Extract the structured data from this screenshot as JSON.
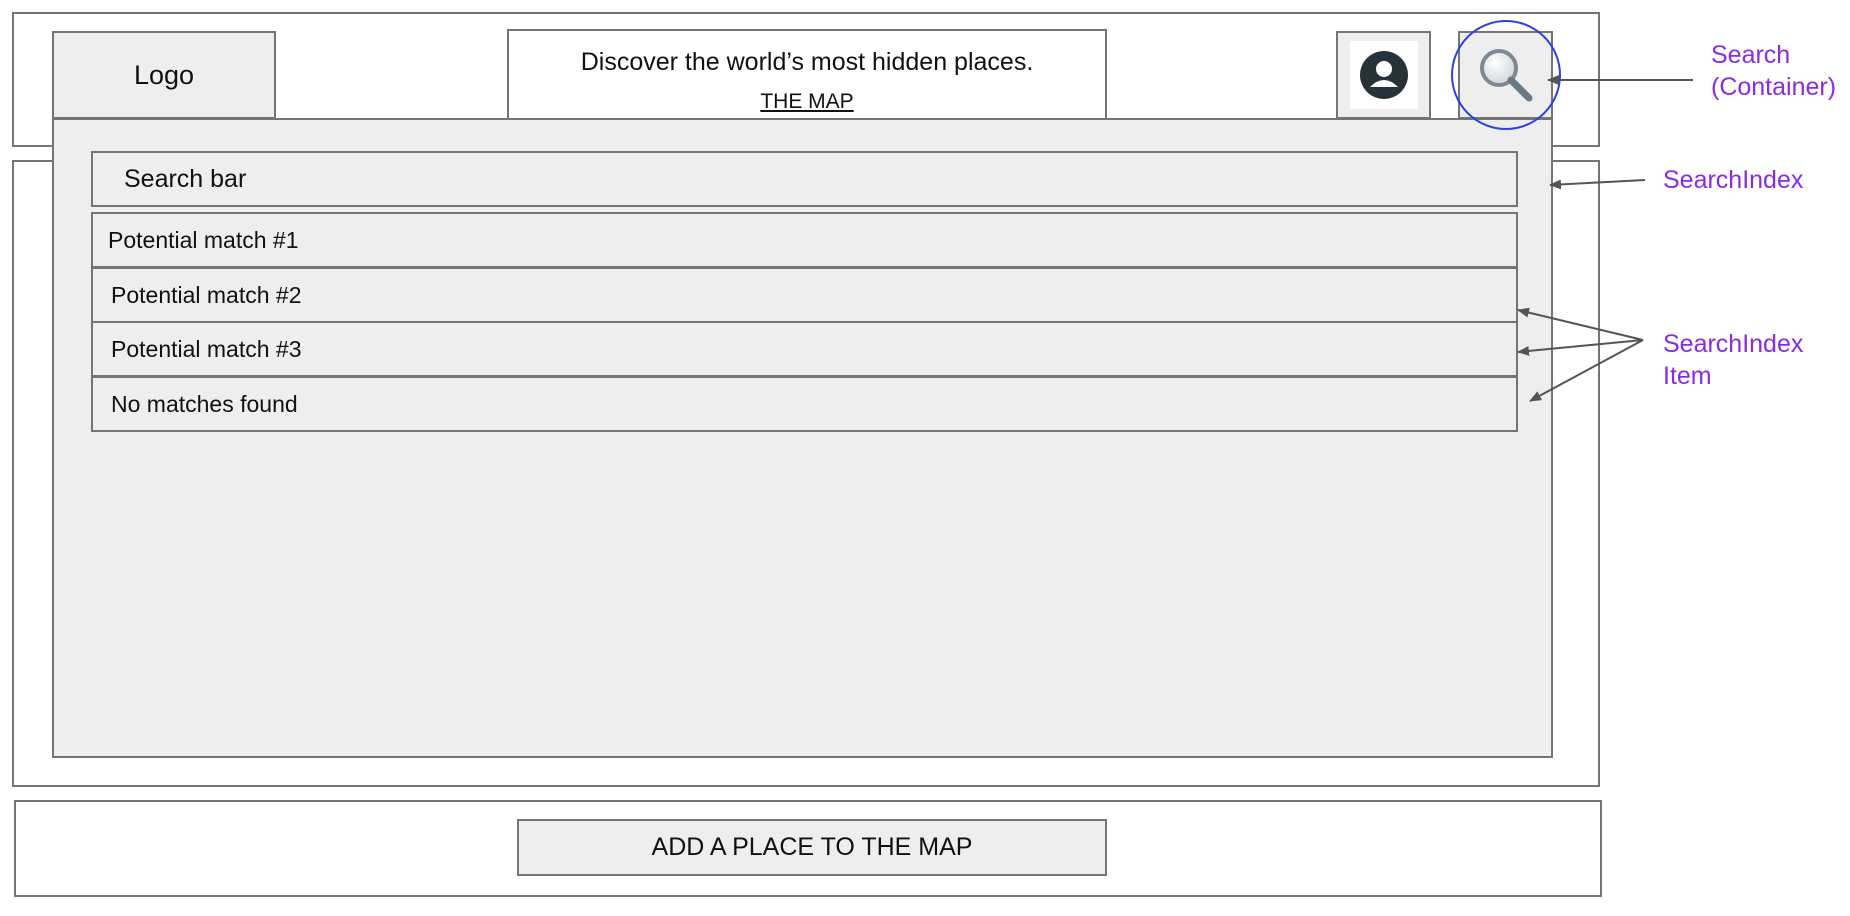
{
  "header": {
    "logo_label": "Logo",
    "tagline": "Discover the world’s most hidden places.",
    "map_link": "THE MAP"
  },
  "icons": {
    "profile": "user-avatar-icon",
    "search": "magnifying-glass-icon"
  },
  "search": {
    "bar_label": "Search bar",
    "items": [
      "Potential match #1",
      "Potential match #2",
      "Potential match #3",
      "No matches found"
    ]
  },
  "footer": {
    "add_place_label": "ADD A PLACE TO THE MAP"
  },
  "annotations": {
    "search_container_line1": "Search",
    "search_container_line2": "(Container)",
    "search_index": "SearchIndex",
    "search_index_item_line1": "SearchIndex",
    "search_index_item_line2": "Item"
  },
  "colors": {
    "annotation": "#8a2be2",
    "highlight_circle": "#2f3fe0",
    "box_fill": "#eeeeee",
    "border": "#757575",
    "arrow": "#555555"
  }
}
